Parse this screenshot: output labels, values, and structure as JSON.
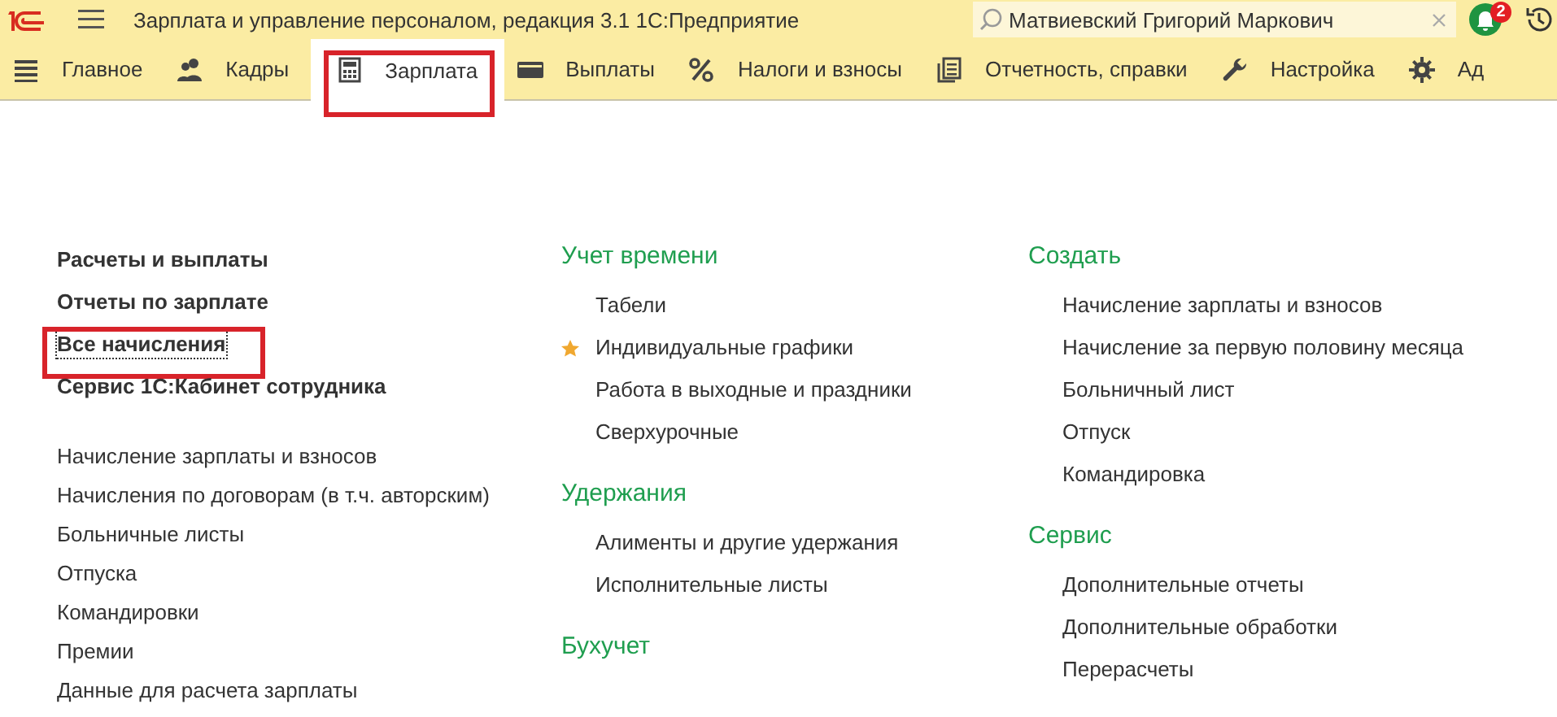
{
  "window": {
    "title": "Зарплата и управление персоналом, редакция 3.1 1С:Предприятие"
  },
  "search": {
    "value": "Матвиевский Григорий Маркович"
  },
  "notifications": {
    "count": "2"
  },
  "sections": [
    {
      "label": "Главное",
      "selected": false,
      "highlighted": false
    },
    {
      "label": "Кадры",
      "selected": false,
      "highlighted": false
    },
    {
      "label": "Зарплата",
      "selected": true,
      "highlighted": true
    },
    {
      "label": "Выплаты",
      "selected": false,
      "highlighted": false
    },
    {
      "label": "Налоги и взносы",
      "selected": false,
      "highlighted": false
    },
    {
      "label": "Отчетность, справки",
      "selected": false,
      "highlighted": false
    },
    {
      "label": "Настройка",
      "selected": false,
      "highlighted": false
    },
    {
      "label": "Ад",
      "selected": false,
      "highlighted": false
    }
  ],
  "main_links": [
    {
      "label": "Расчеты и выплаты",
      "focused": false,
      "highlighted": false
    },
    {
      "label": "Отчеты по зарплате",
      "focused": false,
      "highlighted": false
    },
    {
      "label": "Все начисления",
      "focused": true,
      "highlighted": true
    },
    {
      "label": "Сервис 1С:Кабинет сотрудника",
      "focused": false,
      "highlighted": false
    }
  ],
  "journal_links": [
    "Начисление зарплаты и взносов",
    "Начисления по договорам (в т.ч. авторским)",
    "Больничные листы",
    "Отпуска",
    "Командировки",
    "Премии",
    "Данные для расчета зарплаты"
  ],
  "groups_middle": [
    {
      "title": "Учет времени",
      "items": [
        {
          "label": "Табели",
          "favorite": false
        },
        {
          "label": "Индивидуальные графики",
          "favorite": true
        },
        {
          "label": "Работа в выходные и праздники",
          "favorite": false
        },
        {
          "label": "Сверхурочные",
          "favorite": false
        }
      ]
    },
    {
      "title": "Удержания",
      "items": [
        {
          "label": "Алименты и другие удержания",
          "favorite": false
        },
        {
          "label": "Исполнительные листы",
          "favorite": false
        }
      ]
    },
    {
      "title": "Бухучет"
    }
  ],
  "groups_right": [
    {
      "title": "Создать",
      "items": [
        {
          "label": "Начисление зарплаты и взносов",
          "favorite": false
        },
        {
          "label": "Начисление за первую половину месяца",
          "favorite": false
        },
        {
          "label": "Больничный лист",
          "favorite": false
        },
        {
          "label": "Отпуск",
          "favorite": false
        },
        {
          "label": "Командировка",
          "favorite": false
        }
      ]
    },
    {
      "title": "Сервис",
      "items": [
        {
          "label": "Дополнительные отчеты",
          "favorite": false
        },
        {
          "label": "Дополнительные обработки",
          "favorite": false
        },
        {
          "label": "Перерасчеты",
          "favorite": false
        }
      ]
    }
  ]
}
